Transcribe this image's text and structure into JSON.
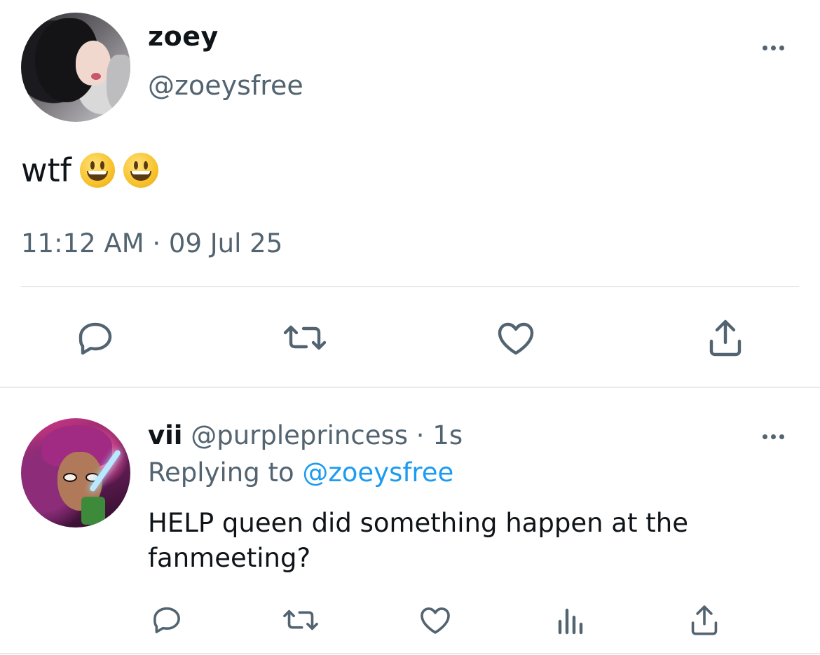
{
  "main_tweet": {
    "display_name": "zoey",
    "handle": "@zoeysfree",
    "text": "wtf",
    "emoji_icons": [
      "grinning-face-icon",
      "grinning-face-icon"
    ],
    "timestamp": "11:12 AM · 09 Jul 25",
    "actions": [
      "reply-icon",
      "retweet-icon",
      "like-icon",
      "share-icon"
    ]
  },
  "reply": {
    "display_name": "vii",
    "handle": "@purpleprincess",
    "separator": "·",
    "age": "1s",
    "replying_prefix": "Replying to",
    "replying_to": "@zoeysfree",
    "text": "HELP queen did something happen at the fanmeeting?",
    "actions": [
      "reply-icon",
      "retweet-icon",
      "like-icon",
      "views-icon",
      "share-icon"
    ]
  },
  "colors": {
    "text": "#0f1419",
    "muted": "#536471",
    "link": "#1d9bf0",
    "divider": "#e7e9ea"
  }
}
